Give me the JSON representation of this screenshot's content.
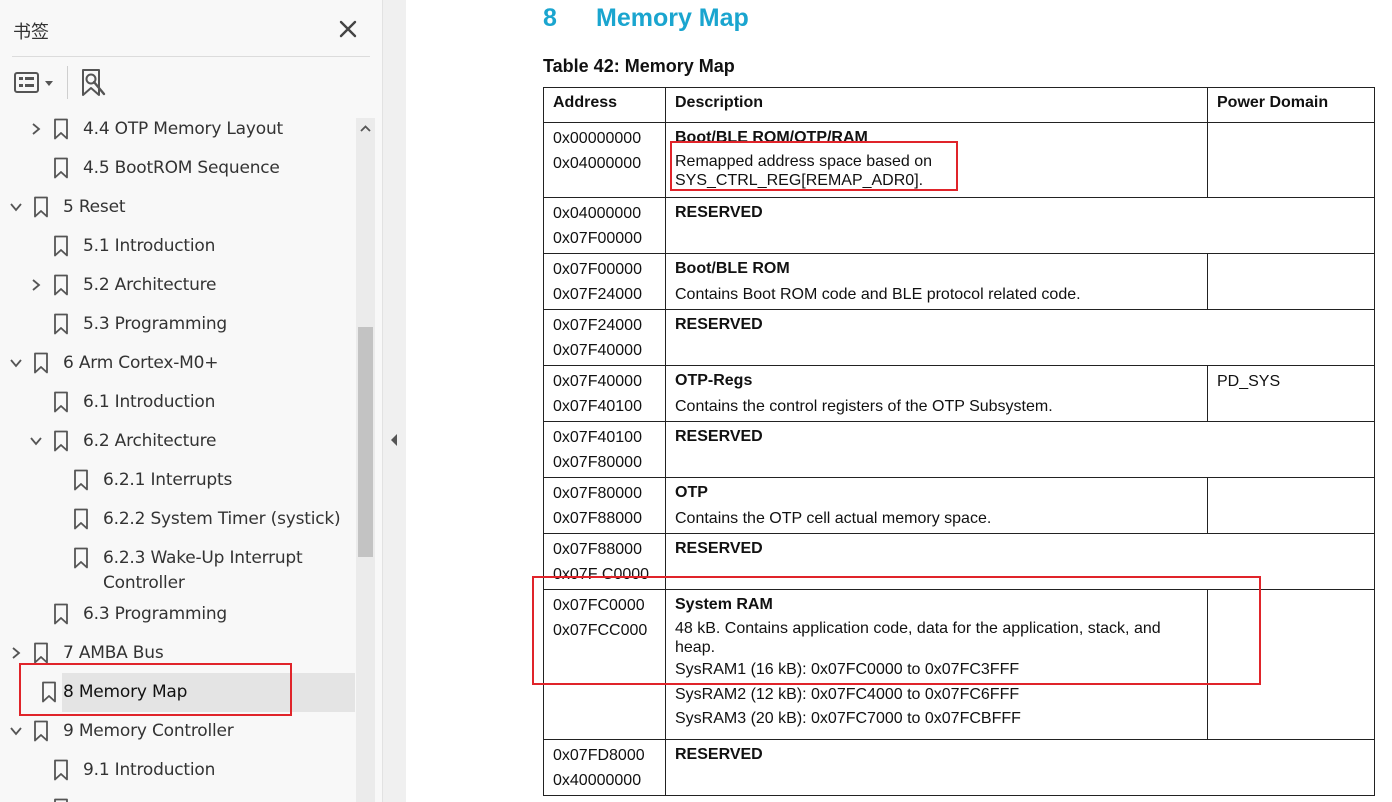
{
  "panel": {
    "title": "书签",
    "close_icon": "close-icon",
    "options_icon": "bookmark-options-icon",
    "find_icon": "find-bookmark-icon"
  },
  "bookmarks": [
    {
      "label": "4.4 OTP Memory Layout",
      "level": 1,
      "chevron": "right"
    },
    {
      "label": "4.5 BootROM Sequence",
      "level": 1,
      "chevron": "none"
    },
    {
      "label": "5 Reset",
      "level": 0,
      "chevron": "down"
    },
    {
      "label": "5.1 Introduction",
      "level": 1,
      "chevron": "none"
    },
    {
      "label": "5.2 Architecture",
      "level": 1,
      "chevron": "right"
    },
    {
      "label": "5.3 Programming",
      "level": 1,
      "chevron": "none"
    },
    {
      "label": "6 Arm Cortex-M0+",
      "level": 0,
      "chevron": "down"
    },
    {
      "label": "6.1 Introduction",
      "level": 1,
      "chevron": "none"
    },
    {
      "label": "6.2 Architecture",
      "level": 1,
      "chevron": "down"
    },
    {
      "label": "6.2.1 Interrupts",
      "level": 2,
      "chevron": "none"
    },
    {
      "label": "6.2.2 System Timer (systick)",
      "level": 2,
      "chevron": "none"
    },
    {
      "label": "6.2.3 Wake-Up Interrupt",
      "label2": "Controller",
      "level": 2,
      "chevron": "none"
    },
    {
      "label": "6.3 Programming",
      "level": 1,
      "chevron": "none"
    },
    {
      "label": "7 AMBA Bus",
      "level": 0,
      "chevron": "right"
    },
    {
      "label": "8 Memory Map",
      "level": 0,
      "chevron": "none",
      "selected": true
    },
    {
      "label": "9 Memory Controller",
      "level": 0,
      "chevron": "down"
    },
    {
      "label": "9.1 Introduction",
      "level": 1,
      "chevron": "none"
    },
    {
      "label": "",
      "level": 1,
      "chevron": "none"
    }
  ],
  "document": {
    "heading_number": "8",
    "heading_title": "Memory Map",
    "table_caption": "Table 42: Memory Map",
    "columns": [
      "Address",
      "Description",
      "Power Domain"
    ],
    "rows": [
      {
        "addr": [
          "0x00000000",
          "0x04000000"
        ],
        "title": "Boot/BLE ROM/OTP/RAM",
        "body": [
          "Remapped address space based on",
          "SYS_CTRL_REG[REMAP_ADR0]."
        ],
        "power": ""
      },
      {
        "addr": [
          "0x04000000",
          "0x07F00000"
        ],
        "title": "RESERVED",
        "body": [],
        "power": null
      },
      {
        "addr": [
          "0x07F00000",
          "0x07F24000"
        ],
        "title": "Boot/BLE ROM",
        "body": [
          "Contains Boot ROM code and BLE protocol related code."
        ],
        "power": ""
      },
      {
        "addr": [
          "0x07F24000",
          "0x07F40000"
        ],
        "title": "RESERVED",
        "body": [],
        "power": null
      },
      {
        "addr": [
          "0x07F40000",
          "0x07F40100"
        ],
        "title": "OTP-Regs",
        "body": [
          "Contains the control registers of the OTP Subsystem."
        ],
        "power": "PD_SYS"
      },
      {
        "addr": [
          "0x07F40100",
          "0x07F80000"
        ],
        "title": "RESERVED",
        "body": [],
        "power": null
      },
      {
        "addr": [
          "0x07F80000",
          "0x07F88000"
        ],
        "title": "OTP",
        "body": [
          "Contains the OTP cell actual memory space."
        ],
        "power": ""
      },
      {
        "addr": [
          "0x07F88000",
          "0x07F C0000"
        ],
        "title": "RESERVED",
        "body": [],
        "power": null
      },
      {
        "addr": [
          "0x07FC0000",
          "0x07FCC000"
        ],
        "title": "System RAM",
        "body": [
          "48 kB. Contains application code, data for the application, stack, and",
          "heap."
        ],
        "sysram": [
          "SysRAM1 (16 kB): 0x07FC0000 to 0x07FC3FFF",
          "SysRAM2 (12 kB): 0x07FC4000 to 0x07FC6FFF",
          "SysRAM3 (20 kB): 0x07FC7000 to 0x07FCBFFF"
        ],
        "power": ""
      },
      {
        "addr": [
          "0x07FD8000",
          "0x40000000"
        ],
        "title": "RESERVED",
        "body": [],
        "power": null
      }
    ]
  },
  "colors": {
    "heading": "#1aa5cf",
    "highlight": "#e0242a",
    "selected_row": "#e4e4e4"
  }
}
